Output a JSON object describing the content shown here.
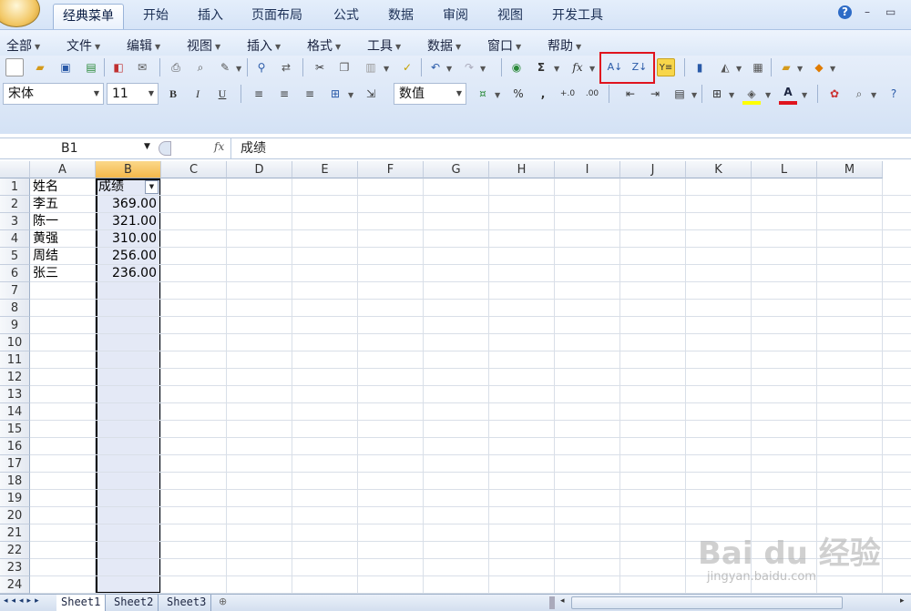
{
  "ribbon": {
    "tabs": [
      "经典菜单",
      "开始",
      "插入",
      "页面布局",
      "公式",
      "数据",
      "审阅",
      "视图",
      "开发工具"
    ],
    "active_tab": "经典菜单",
    "help_glyph": "?",
    "minimize_glyph": "–",
    "restore_glyph": "▭"
  },
  "menubar": [
    "全部",
    "文件",
    "编辑",
    "视图",
    "插入",
    "格式",
    "工具",
    "数据",
    "窗口",
    "帮助"
  ],
  "toolbar": {
    "font_name": "宋体",
    "font_size": "11",
    "bold": "B",
    "italic": "I",
    "underline": "U",
    "number_format": "数值",
    "percent": "%",
    "comma": ",",
    "sum": "Σ",
    "fx": "fx",
    "sort_asc_icon": "sort-ascending-icon",
    "sort_desc_icon": "sort-descending-icon",
    "font_color": "A",
    "highlight_color": "#ffff00",
    "font_color_swatch": "#e0141e"
  },
  "formula_bar": {
    "name_box": "B1",
    "fx_label": "fx",
    "content": "成绩"
  },
  "grid": {
    "columns": [
      "A",
      "B",
      "C",
      "D",
      "E",
      "F",
      "G",
      "H",
      "I",
      "J",
      "K",
      "L",
      "M"
    ],
    "rows": [
      "1",
      "2",
      "3",
      "4",
      "5",
      "6",
      "7",
      "8",
      "9",
      "10",
      "11",
      "12",
      "13",
      "14",
      "15",
      "16",
      "17",
      "18",
      "19",
      "20",
      "21",
      "22",
      "23",
      "24"
    ],
    "selected_column": "B",
    "cells": {
      "A1": "姓名",
      "B1": "成绩",
      "A2": "李五",
      "B2": "369.00",
      "A3": "陈一",
      "B3": "321.00",
      "A4": "黄强",
      "B4": "310.00",
      "A5": "周结",
      "B5": "256.00",
      "A6": "张三",
      "B6": "236.00"
    }
  },
  "sheets": [
    "Sheet1",
    "Sheet2",
    "Sheet3"
  ],
  "active_sheet": "Sheet1",
  "watermark": {
    "brand": "Bai du 经验",
    "url": "jingyan.baidu.com"
  }
}
